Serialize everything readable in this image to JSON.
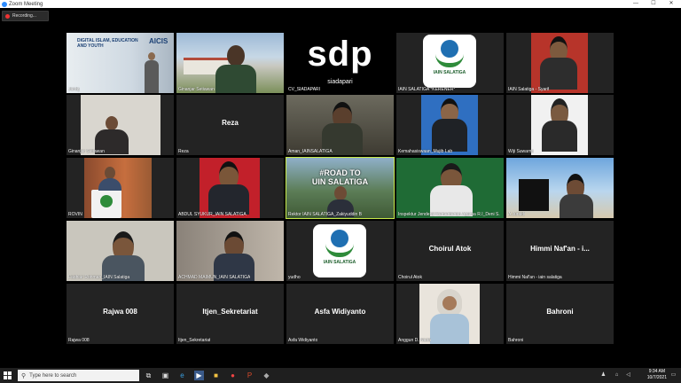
{
  "window": {
    "title": "Zoom Meeting",
    "minimize": "—",
    "maximize": "☐",
    "close": "✕"
  },
  "recording": {
    "label": "Recording..."
  },
  "tiles": [
    {
      "caption": "Jandy",
      "slide_lines": [
        "AICIS",
        "DIGITAL ISLAM, EDUCATION AND YOUTH"
      ]
    },
    {
      "caption": "Ahmad Al Sholihin"
    },
    {
      "caption": "CV_SIADAPARI",
      "logo_main": "sdp",
      "logo_sub": "siadapari"
    },
    {
      "caption": "IAIN SALATIGA *KERENER*",
      "logo_text": "IAIN SALATIGA"
    },
    {
      "caption": "IAIN Salatiga - Syarif"
    },
    {
      "caption": "Ginanjar Setiawan"
    },
    {
      "caption": "Reza",
      "name": "Reza"
    },
    {
      "caption": "Aman_IAINSALATIGA"
    },
    {
      "caption": "Kemahasiswaan_Mujib Lab"
    },
    {
      "caption": "Wiji Suwarno"
    },
    {
      "caption": "ROVIN"
    },
    {
      "caption": "ABDUL SYUKUR_IAIN SALATIGA"
    },
    {
      "caption": "Rektor IAIN SALATIGA_Zakiyuddin B",
      "banner_line1": "#ROAD TO",
      "banner_line2": "UIN SALATIGA"
    },
    {
      "caption": "Inspektur Jenderal Kementerian Agama R.I_Deni S."
    },
    {
      "caption": "A Juraidi"
    },
    {
      "caption": "Fadhlur Rohman_IAIN Salatiga"
    },
    {
      "caption": "ACHMAD MAIMUN_IAIN SALATIGA"
    },
    {
      "caption": "yudho",
      "logo_text": "IAIN SALATIGA"
    },
    {
      "caption": "Choirul Atok",
      "name": "Choirul Atok"
    },
    {
      "caption": "Himmi Naf'an - iain salatiga",
      "name": "Himmi Naf'an - i..."
    },
    {
      "caption": "Rajwa 008",
      "name": "Rajwa 008"
    },
    {
      "caption": "Itjen_Sekretariat",
      "name": "Itjen_Sekretariat"
    },
    {
      "caption": "Asfa Widiyanto",
      "name": "Asfa Widiyanto"
    },
    {
      "caption": "Anggun D. Nada"
    },
    {
      "caption": "Bahroni",
      "name": "Bahroni"
    }
  ],
  "taskbar": {
    "search_placeholder": "Type here to search",
    "time": "9:34 AM",
    "date": "10/7/2021"
  },
  "colors": {
    "zoom_blue": "#2d8cff",
    "active_speaker": "#c7e84a",
    "tile_bg": "#232323"
  }
}
